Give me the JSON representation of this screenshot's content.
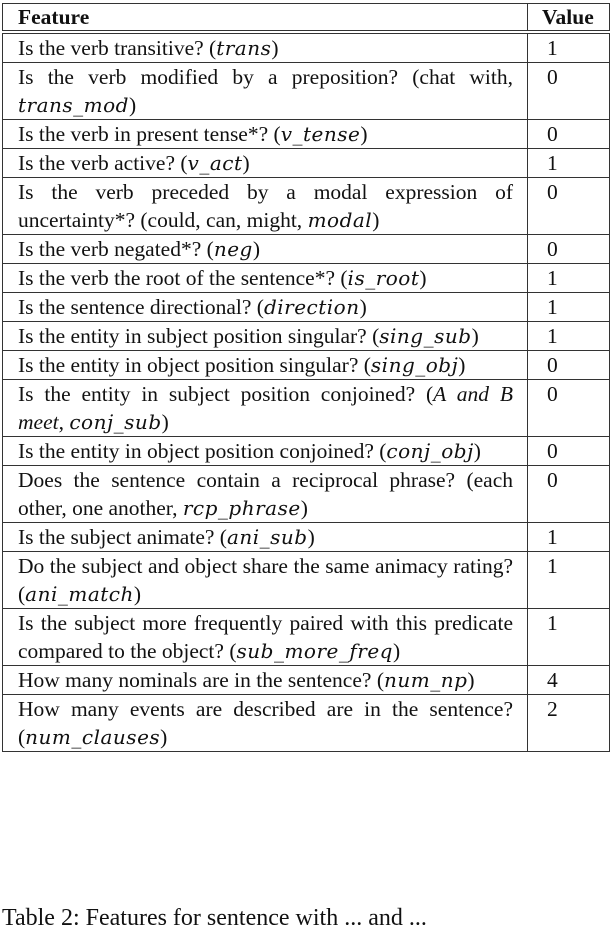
{
  "table": {
    "headers": {
      "feature": "Feature",
      "value": "Value"
    },
    "rows": [
      {
        "question": "Is the verb transitive? (",
        "example": "",
        "code": "trans",
        "close": ")",
        "value": "1"
      },
      {
        "question": "Is the verb modified by a preposition? (chat with, ",
        "example": "",
        "code": "trans_mod",
        "close": ")",
        "value": "0"
      },
      {
        "question": "Is the verb in present tense*? (",
        "example": "",
        "code": "v_tense",
        "close": ")",
        "value": "0"
      },
      {
        "question": "Is the verb active? (",
        "example": "",
        "code": "v_act",
        "close": ")",
        "value": "1"
      },
      {
        "question": "Is the verb preceded by a modal expression of uncertainty*? (could, can, might, ",
        "example": "",
        "code": "modal",
        "close": ")",
        "value": "0"
      },
      {
        "question": "Is the verb negated*? (",
        "example": "",
        "code": "neg",
        "close": ")",
        "value": "0"
      },
      {
        "question": "Is the verb the root of the sentence*? (",
        "example": "",
        "code": "is_root",
        "close": ")",
        "value": "1"
      },
      {
        "question": "Is the sentence directional? (",
        "example": "",
        "code": "direction",
        "close": ")",
        "value": "1"
      },
      {
        "question": "Is the entity in subject position singular? (",
        "example": "",
        "code": "sing_sub",
        "close": ")",
        "value": "1"
      },
      {
        "question": "Is the entity in object position singular? (",
        "example": "",
        "code": "sing_obj",
        "close": ")",
        "value": "0"
      },
      {
        "question": "Is the entity in subject position conjoined? (",
        "example": "A and B meet",
        "code": "conj_sub",
        "close": ")",
        "value": "0"
      },
      {
        "question": "Is the entity in object position conjoined? (",
        "example": "",
        "code": "conj_obj",
        "close": ")",
        "value": "0"
      },
      {
        "question": "Does the sentence contain a reciprocal phrase? (each other, one another, ",
        "example": "",
        "code": "rcp_phrase",
        "close": ")",
        "value": "0"
      },
      {
        "question": "Is the subject animate? (",
        "example": "",
        "code": "ani_sub",
        "close": ")",
        "value": "1"
      },
      {
        "question": "Do the subject and object share the same animacy rating? (",
        "example": "",
        "code": "ani_match",
        "close": ")",
        "value": "1"
      },
      {
        "question": "Is the subject more frequently paired with this predicate compared to the object? (",
        "example": "",
        "code": "sub_more_freq",
        "close": ")",
        "value": "1"
      },
      {
        "question": "How many nominals are in the sentence? (",
        "example": "",
        "code": "num_np",
        "close": ")",
        "value": "4"
      },
      {
        "question": "How many events are described are in the sen­tence? (",
        "example": "",
        "code": "num_clauses",
        "close": ")",
        "value": "2"
      }
    ]
  },
  "caption": "Table 2: Features for sentence with ... and ..."
}
